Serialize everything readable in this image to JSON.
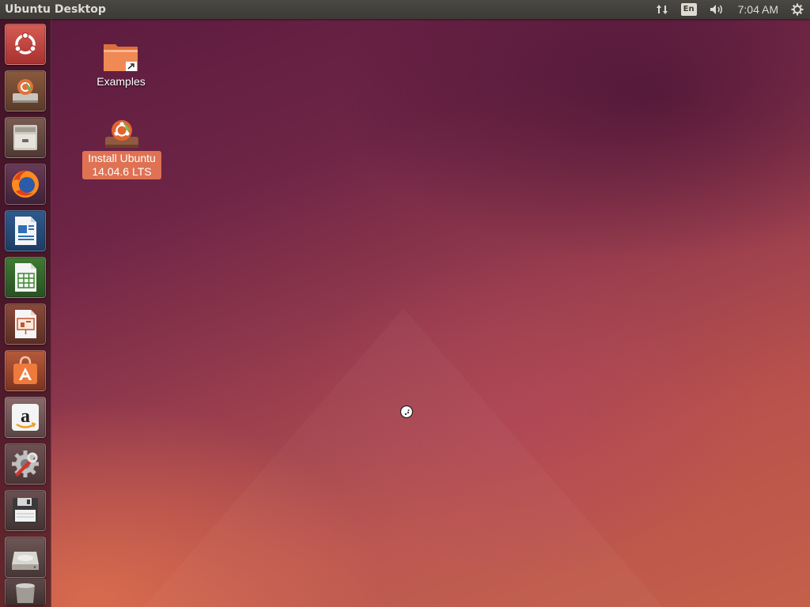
{
  "top_panel": {
    "title": "Ubuntu Desktop",
    "keyboard_layout": "En",
    "clock": "7:04 AM",
    "icons": [
      "network-updown-icon",
      "sound-icon",
      "settings-gear-icon"
    ]
  },
  "launcher": {
    "items": [
      {
        "name": "Dash home",
        "icon": "ubuntu-logo-icon"
      },
      {
        "name": "Install Ubuntu 14.04.6 LTS",
        "icon": "installer-icon"
      },
      {
        "name": "Files",
        "icon": "file-cabinet-icon"
      },
      {
        "name": "Firefox Web Browser",
        "icon": "firefox-icon"
      },
      {
        "name": "LibreOffice Writer",
        "icon": "writer-doc-icon"
      },
      {
        "name": "LibreOffice Calc",
        "icon": "calc-spreadsheet-icon"
      },
      {
        "name": "LibreOffice Impress",
        "icon": "impress-presentation-icon"
      },
      {
        "name": "Ubuntu Software Center",
        "icon": "software-bag-icon"
      },
      {
        "name": "Amazon",
        "icon": "amazon-icon"
      },
      {
        "name": "System Settings",
        "icon": "settings-wrench-icon"
      },
      {
        "name": "Floppy / Save",
        "icon": "floppy-icon"
      },
      {
        "name": "Drive",
        "icon": "hard-drive-icon"
      },
      {
        "name": "Trash",
        "icon": "trash-icon"
      }
    ]
  },
  "desktop": {
    "icons": [
      {
        "label": "Examples",
        "icon": "folder-link-icon",
        "selected": false
      },
      {
        "label": "Install Ubuntu\n14.04.6 LTS",
        "icon": "installer-icon",
        "selected": true
      }
    ]
  },
  "colors": {
    "accent": "#de7253",
    "panel": "#3c3b37",
    "panel_text": "#dfdbd2"
  }
}
